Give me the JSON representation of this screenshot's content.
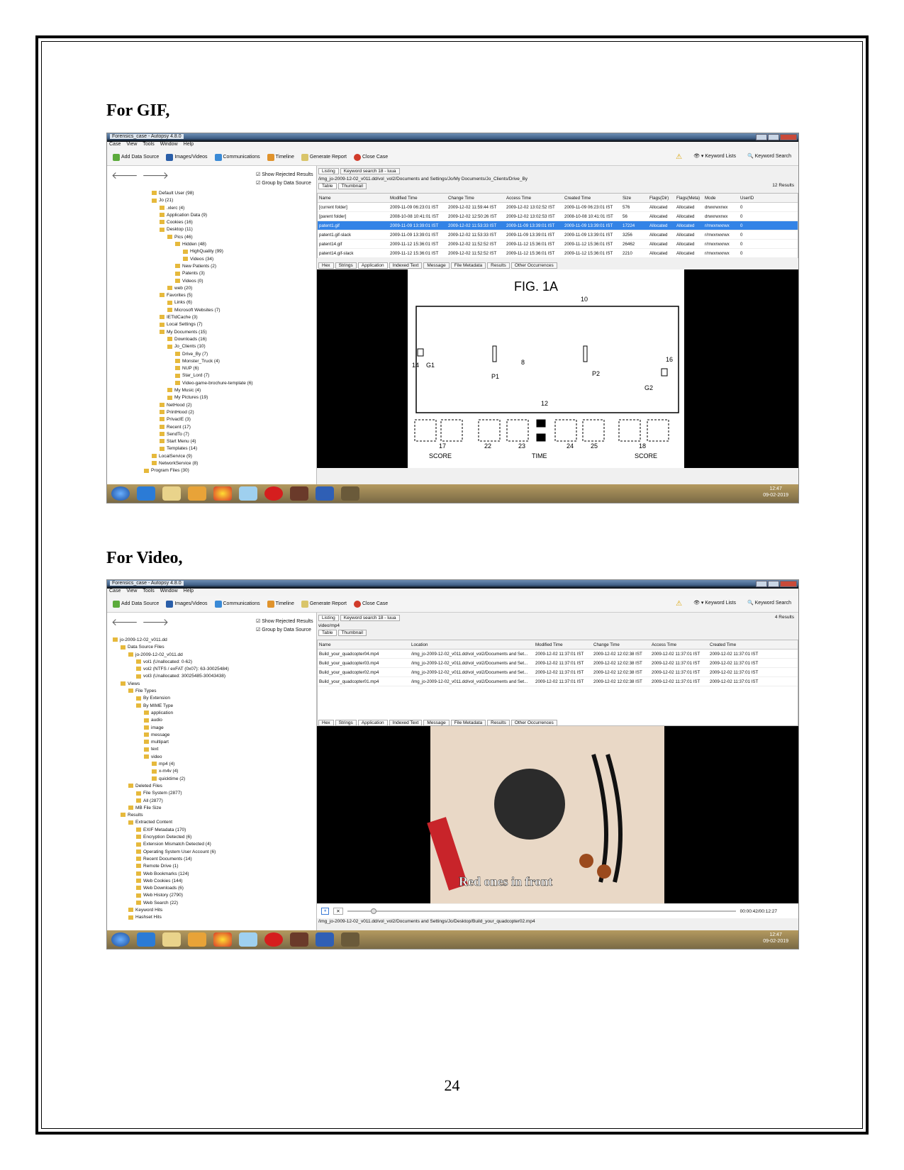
{
  "headings": {
    "gif": "For GIF,",
    "video": "For Video,"
  },
  "page_number": "24",
  "window": {
    "title": "Forensics_case - Autopsy 4.8.0",
    "menu": [
      "Case",
      "View",
      "Tools",
      "Window",
      "Help"
    ],
    "toolbar": [
      "Add Data Source",
      "Images/Videos",
      "Communications",
      "Timeline",
      "Generate Report",
      "Close Case"
    ],
    "keyword_lists": "Keyword Lists",
    "keyword_search": "Keyword Search",
    "show_rejected": "Show Rejected Results",
    "group_by": "Group by Data Source",
    "viewer_tabs": [
      "Hex",
      "Strings",
      "Application",
      "Indexed Text",
      "Message",
      "File Metadata",
      "Results",
      "Other Occurrences"
    ],
    "clock_time": "12:47",
    "clock_date": "09-02-2019"
  },
  "shot1": {
    "listing_tab": "Listing",
    "search_tab": "Keyword search 18 - luua",
    "path": "/img_jo-2009-12-02_v011.dd/vol_vol2/Documents and Settings/Jo/My Documents/Jo_Clients/Drive_By",
    "view_tabs": [
      "Table",
      "Thumbnail"
    ],
    "results": "12 Results",
    "columns": [
      "Name",
      "Modified Time",
      "Change Time",
      "Access Time",
      "Created Time",
      "Size",
      "Flags(Dir)",
      "Flags(Meta)",
      "Mode",
      "UserID"
    ],
    "rows": [
      [
        "[current folder]",
        "2009-11-09 06:23:01 IST",
        "2009-12-02 11:59:44 IST",
        "2009-12-02 13:02:52 IST",
        "2009-11-09 06:23:01 IST",
        "576",
        "Allocated",
        "Allocated",
        "drwxrwxrwx",
        "0"
      ],
      [
        "[parent folder]",
        "2008-10-08 10:41:01 IST",
        "2009-12-02 12:50:26 IST",
        "2009-12-02 13:02:53 IST",
        "2008-10-08 10:41:01 IST",
        "56",
        "Allocated",
        "Allocated",
        "drwxrwxrwx",
        "0"
      ],
      [
        "patent1.gif",
        "2009-11-09 13:39:01 IST",
        "2009-12-02 11:53:33 IST",
        "2009-11-09 13:39:01 IST",
        "2009-11-09 13:39:01 IST",
        "17224",
        "Allocated",
        "Allocated",
        "r/rrwxrwxrwx",
        "0"
      ],
      [
        "patent1.gif-slack",
        "2009-11-09 13:39:01 IST",
        "2009-12-02 11:53:33 IST",
        "2009-11-09 13:39:01 IST",
        "2009-11-09 13:39:01 IST",
        "3256",
        "Allocated",
        "Allocated",
        "r/rrwxrwxrwx",
        "0"
      ],
      [
        "patent14.gif",
        "2009-11-12 15:36:01 IST",
        "2009-12-02 11:52:52 IST",
        "2009-11-12 15:36:01 IST",
        "2009-11-12 15:36:01 IST",
        "26462",
        "Allocated",
        "Allocated",
        "r/rrwxrwxrwx",
        "0"
      ],
      [
        "patent14.gif-slack",
        "2009-11-12 15:36:01 IST",
        "2009-12-02 11:52:52 IST",
        "2009-11-12 15:36:01 IST",
        "2009-11-12 15:36:01 IST",
        "2210",
        "Allocated",
        "Allocated",
        "r/rrwxrwxrwx",
        "0"
      ]
    ],
    "tree": [
      {
        "d": 5,
        "t": "Default User (98)"
      },
      {
        "d": 5,
        "t": "Jo (21)"
      },
      {
        "d": 6,
        "t": ".xlerc (4)"
      },
      {
        "d": 6,
        "t": "Application Data (9)"
      },
      {
        "d": 6,
        "t": "Cookies (16)"
      },
      {
        "d": 6,
        "t": "Desktop (11)"
      },
      {
        "d": 7,
        "t": "Pics (46)"
      },
      {
        "d": 8,
        "t": "Hidden (48)"
      },
      {
        "d": 9,
        "t": "HighQuality (99)"
      },
      {
        "d": 9,
        "t": "Videos (34)"
      },
      {
        "d": 8,
        "t": "New Patients (2)"
      },
      {
        "d": 8,
        "t": "Patents (3)"
      },
      {
        "d": 8,
        "t": "Videos (0)"
      },
      {
        "d": 7,
        "t": "web (20)"
      },
      {
        "d": 6,
        "t": "Favorites (5)"
      },
      {
        "d": 7,
        "t": "Links (6)"
      },
      {
        "d": 7,
        "t": "Microsoft Websites (7)"
      },
      {
        "d": 6,
        "t": "IETldCache (3)"
      },
      {
        "d": 6,
        "t": "Local Settings (7)"
      },
      {
        "d": 6,
        "t": "My Documents (15)"
      },
      {
        "d": 7,
        "t": "Downloads (16)"
      },
      {
        "d": 7,
        "t": "Jo_Clients (10)"
      },
      {
        "d": 8,
        "t": "Drive_By (7)"
      },
      {
        "d": 8,
        "t": "Monster_Truck (4)"
      },
      {
        "d": 8,
        "t": "NUP (6)"
      },
      {
        "d": 8,
        "t": "Star_Lord (7)"
      },
      {
        "d": 8,
        "t": "Video-game-brochure-template (6)"
      },
      {
        "d": 7,
        "t": "My Music (4)"
      },
      {
        "d": 7,
        "t": "My Pictures (19)"
      },
      {
        "d": 6,
        "t": "NetHood (2)"
      },
      {
        "d": 6,
        "t": "PrintHood (2)"
      },
      {
        "d": 6,
        "t": "PrivacIE (3)"
      },
      {
        "d": 6,
        "t": "Recent (17)"
      },
      {
        "d": 6,
        "t": "SendTo (7)"
      },
      {
        "d": 6,
        "t": "Start Menu (4)"
      },
      {
        "d": 6,
        "t": "Templates (14)"
      },
      {
        "d": 5,
        "t": "LocalService (9)"
      },
      {
        "d": 5,
        "t": "NetworkService (8)"
      },
      {
        "d": 4,
        "t": "Program Files (30)"
      }
    ],
    "figure": {
      "title": "FIG. 1A",
      "labels": [
        "10",
        "14",
        "G1",
        "P1",
        "8",
        "P2",
        "16",
        "G2",
        "12",
        "17",
        "22",
        "23",
        "24",
        "25",
        "18"
      ],
      "bottom": [
        "SCORE",
        "TIME",
        "SCORE"
      ]
    }
  },
  "shot2": {
    "listing_tab": "Listing",
    "search_tab": "Keyword search 18 - luua",
    "path": "video/mp4",
    "view_tabs": [
      "Table",
      "Thumbnail"
    ],
    "results": "4 Results",
    "columns": [
      "Name",
      "Location",
      "Modified Time",
      "Change Time",
      "Access Time",
      "Created Time"
    ],
    "rows": [
      [
        "Build_your_quadcopter04.mp4",
        "/img_jo-2009-12-02_v011.dd/vol_vol2/Documents and Set...",
        "2009-12-02 11:37:01 IST",
        "2009-12-02 12:02:38 IST",
        "2009-12-02 11:37:01 IST",
        "2009-12-02 11:37:01 IST"
      ],
      [
        "Build_your_quadcopter03.mp4",
        "/img_jo-2009-12-02_v011.dd/vol_vol2/Documents and Set...",
        "2009-12-02 11:37:01 IST",
        "2009-12-02 12:02:38 IST",
        "2009-12-02 11:37:01 IST",
        "2009-12-02 11:37:01 IST"
      ],
      [
        "Build_your_quadcopter02.mp4",
        "/img_jo-2009-12-02_v011.dd/vol_vol2/Documents and Set...",
        "2009-12-02 11:37:01 IST",
        "2009-12-02 12:02:38 IST",
        "2009-12-02 11:37:01 IST",
        "2009-12-02 11:37:01 IST"
      ],
      [
        "Build_your_quadcopter01.mp4",
        "/img_jo-2009-12-02_v011.dd/vol_vol2/Documents and Set...",
        "2009-12-02 11:37:01 IST",
        "2009-12-02 12:02:38 IST",
        "2009-12-02 11:37:01 IST",
        "2009-12-02 11:37:01 IST"
      ]
    ],
    "tree": [
      {
        "d": 0,
        "t": "jo-2009-12-02_v011.dd"
      },
      {
        "d": 1,
        "t": "Data Source Files"
      },
      {
        "d": 2,
        "t": "jo-2009-12-02_v011.dd"
      },
      {
        "d": 3,
        "t": "vol1 (Unallocated: 0-62)"
      },
      {
        "d": 3,
        "t": "vol2 (NTFS / exFAT (0x07): 63-30025484)"
      },
      {
        "d": 3,
        "t": "vol3 (Unallocated: 30025485-30043438)"
      },
      {
        "d": 1,
        "t": "Views"
      },
      {
        "d": 2,
        "t": "File Types"
      },
      {
        "d": 3,
        "t": "By Extension"
      },
      {
        "d": 3,
        "t": "By MIME Type"
      },
      {
        "d": 4,
        "t": "application"
      },
      {
        "d": 4,
        "t": "audio"
      },
      {
        "d": 4,
        "t": "image"
      },
      {
        "d": 4,
        "t": "message"
      },
      {
        "d": 4,
        "t": "multipart"
      },
      {
        "d": 4,
        "t": "text"
      },
      {
        "d": 4,
        "t": "video"
      },
      {
        "d": 5,
        "t": "mp4 (4)"
      },
      {
        "d": 5,
        "t": "x-m4v (4)"
      },
      {
        "d": 5,
        "t": "quicktime (2)"
      },
      {
        "d": 2,
        "t": "Deleted Files"
      },
      {
        "d": 3,
        "t": "File System (2877)"
      },
      {
        "d": 3,
        "t": "All (2877)"
      },
      {
        "d": 2,
        "t": "MB File Size"
      },
      {
        "d": 1,
        "t": "Results"
      },
      {
        "d": 2,
        "t": "Extracted Content"
      },
      {
        "d": 3,
        "t": "EXIF Metadata (170)"
      },
      {
        "d": 3,
        "t": "Encryption Detected (6)"
      },
      {
        "d": 3,
        "t": "Extension Mismatch Detected (4)"
      },
      {
        "d": 3,
        "t": "Operating System User Account (6)"
      },
      {
        "d": 3,
        "t": "Recent Documents (14)"
      },
      {
        "d": 3,
        "t": "Remote Drive (1)"
      },
      {
        "d": 3,
        "t": "Web Bookmarks (124)"
      },
      {
        "d": 3,
        "t": "Web Cookies (144)"
      },
      {
        "d": 3,
        "t": "Web Downloads (6)"
      },
      {
        "d": 3,
        "t": "Web History (2790)"
      },
      {
        "d": 3,
        "t": "Web Search (22)"
      },
      {
        "d": 2,
        "t": "Keyword Hits"
      },
      {
        "d": 2,
        "t": "Hashset Hits"
      }
    ],
    "video_caption": "Red ones in front",
    "player_time": "00:00:42/00:12:27",
    "status_path": "/img_jo-2009-12-02_v011.dd/vol_vol2/Documents and Settings/Jo/Desktop/Build_your_quadcopter02.mp4"
  },
  "colors": {
    "selection": "#3383e6",
    "taskbar": "#9b8555",
    "folder": "#e6b93c"
  }
}
